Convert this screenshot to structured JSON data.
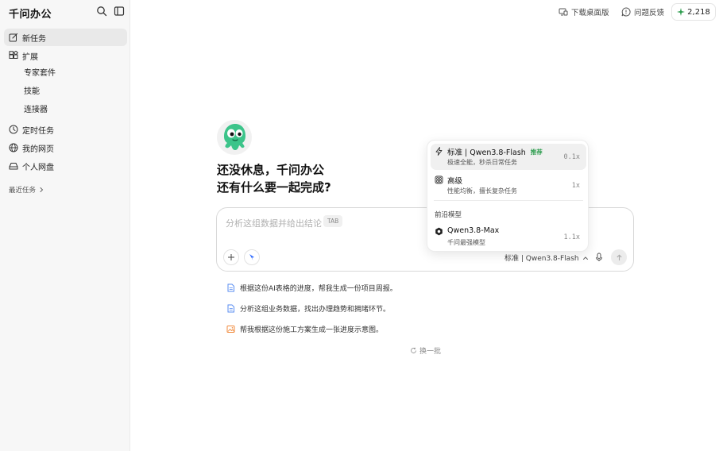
{
  "sidebar": {
    "brand": "千问办公",
    "items": [
      {
        "label": "新任务",
        "icon": "edit-icon"
      },
      {
        "label": "扩展",
        "icon": "extension-icon"
      },
      {
        "label": "定时任务",
        "icon": "clock-icon"
      },
      {
        "label": "我的网页",
        "icon": "globe-icon"
      },
      {
        "label": "个人网盘",
        "icon": "drive-icon"
      }
    ],
    "sub_items": [
      "专家套件",
      "技能",
      "连接器"
    ],
    "recent_label": "最近任务"
  },
  "topbar": {
    "download_label": "下载桌面版",
    "feedback_label": "问题反馈",
    "points": "2,218"
  },
  "main": {
    "greeting_line1": "还没休息，千问办公",
    "greeting_line2": "还有什么要一起完成?",
    "composer": {
      "placeholder": "分析这组数据并给出结论",
      "tab_hint": "TAB",
      "model_label": "标准 | Qwen3.8-Flash"
    },
    "suggestions": [
      "根据这份AI表格的进度，帮我生成一份项目周报。",
      "分析这组业务数据，找出办理趋势和拥堵环节。",
      "帮我根据这份施工方案生成一张进度示意图。"
    ],
    "refresh_label": "换一批"
  },
  "dropdown": {
    "options": [
      {
        "title": "标准 | Qwen3.8-Flash",
        "badge": "推荐",
        "subtitle": "极速全能，秒杀日常任务",
        "multiplier": "0.1x"
      },
      {
        "title": "高级",
        "subtitle": "性能均衡，擅长复杂任务",
        "multiplier": "1x"
      }
    ],
    "section_label": "前沿模型",
    "frontier": {
      "title": "Qwen3.8-Max",
      "subtitle": "千问最强模型",
      "multiplier": "1.1x"
    }
  },
  "colors": {
    "accent_green": "#2e9d4f",
    "sidebar_bg": "#f7f7f7",
    "brand_blue": "#2f6bff"
  }
}
